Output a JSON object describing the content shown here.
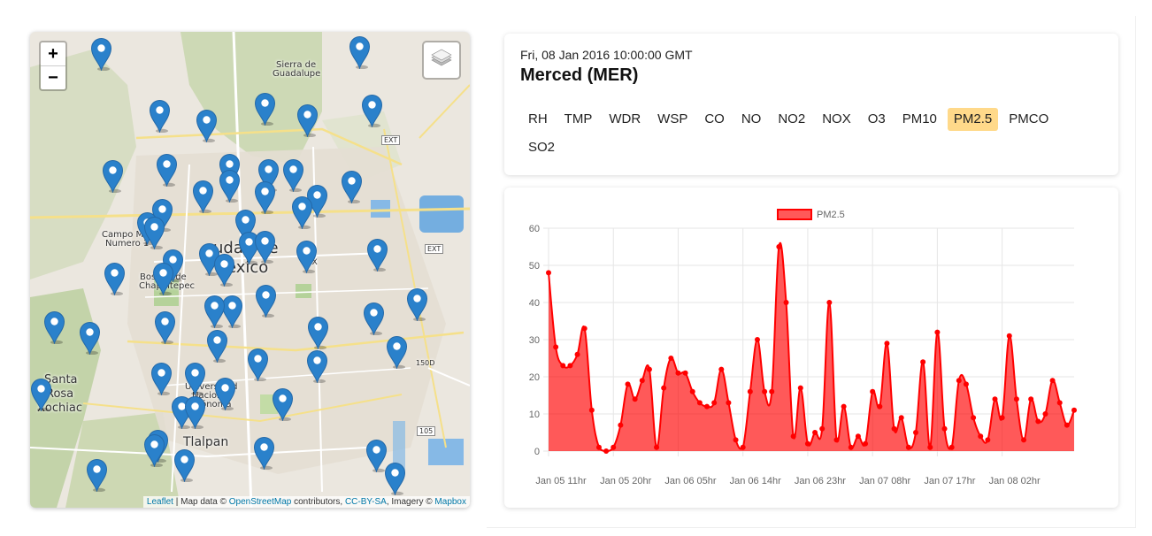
{
  "map": {
    "zoom_in": "+",
    "zoom_out": "−",
    "labels": {
      "sierra": "Sierra de",
      "guadalupe": "Guadalupe",
      "campo": "Campo Militar",
      "numero": "Numero 1",
      "ciudad": "udad de",
      "mexico": "éxico",
      "bosque": "Bosque de",
      "chapultepec": "Chapultepec",
      "santa": "Santa",
      "rosa": "Rosa",
      "xochiac": "Xochiac",
      "universidad": "Universidad",
      "nacional": "Nacional",
      "autonoma": "Autónoma",
      "tlalpan": "Tlalpan",
      "ext1": "EXT",
      "ext2": "EXT",
      "r150": "150D",
      "r105": "105",
      "ex": "EX"
    },
    "attribution": {
      "leaflet": "Leaflet",
      "sep1": " | Map data © ",
      "osm": "OpenStreetMap",
      "sep2": " contributors, ",
      "ccbysa": "CC-BY-SA",
      "sep3": ", Imagery © ",
      "mapbox": "Mapbox"
    },
    "pin_color": "#2a81cb",
    "icons": {
      "layers": "layers-icon",
      "pin": "map-pin-icon"
    }
  },
  "station": {
    "datetime": "Fri, 08 Jan 2016 10:00:00 GMT",
    "name": "Merced (MER)"
  },
  "pollutants": [
    "RH",
    "TMP",
    "WDR",
    "WSP",
    "CO",
    "NO",
    "NO2",
    "NOX",
    "O3",
    "PM10",
    "PM2.5",
    "PMCO",
    "SO2"
  ],
  "selected_pollutant": "PM2.5",
  "chart_data": {
    "type": "area",
    "title": "",
    "xlabel": "",
    "ylabel": "",
    "ylim": [
      0,
      60
    ],
    "yticks": [
      0,
      10,
      20,
      30,
      40,
      50,
      60
    ],
    "grid": true,
    "legend": "top-center",
    "color": "#ff0000",
    "fill": "rgba(255,0,0,0.65)",
    "x_start": "Jan 05 11hr",
    "x_step_hours": 1,
    "xticks": [
      "Jan 05 11hr",
      "Jan 05 20hr",
      "Jan 06 05hr",
      "Jan 06 14hr",
      "Jan 06 23hr",
      "Jan 07 08hr",
      "Jan 07 17hr",
      "Jan 08 02hr"
    ],
    "series": [
      {
        "name": "PM2.5",
        "values": [
          48,
          28,
          23,
          23,
          26,
          33,
          11,
          1,
          0,
          1,
          7,
          18,
          14,
          19,
          22,
          1,
          17,
          25,
          21,
          21,
          16,
          13,
          12,
          13,
          22,
          13,
          3,
          1,
          16,
          30,
          16,
          16,
          55,
          40,
          4,
          17,
          2,
          5,
          6,
          40,
          3,
          12,
          1,
          4,
          2,
          16,
          12,
          29,
          6,
          9,
          1,
          5,
          24,
          1,
          32,
          6,
          1,
          19,
          18,
          9,
          4,
          3,
          14,
          9,
          31,
          14,
          3,
          14,
          8,
          10,
          19,
          13,
          7,
          11
        ]
      }
    ]
  }
}
